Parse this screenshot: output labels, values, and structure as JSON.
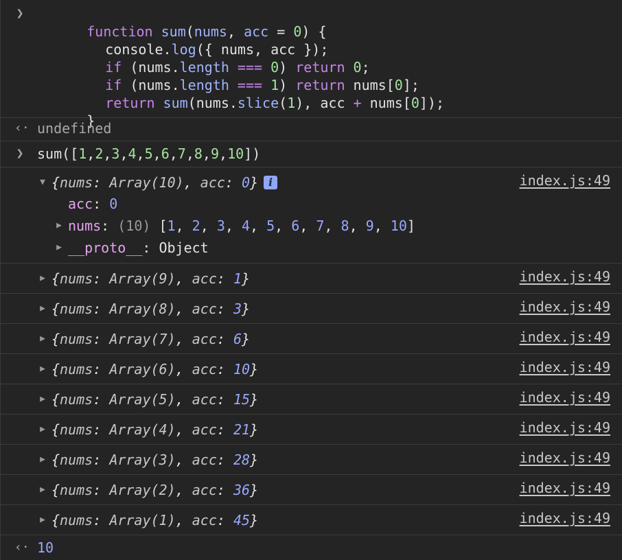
{
  "input1": {
    "code_lines": [
      [
        "function",
        "sum",
        "(",
        "nums",
        ", ",
        "acc",
        " = ",
        "0",
        ") {"
      ],
      [
        "console.",
        "log",
        "({ ",
        "nums",
        ", ",
        "acc",
        " });"
      ],
      [
        "if",
        " (nums.",
        "length",
        " === ",
        "0",
        ") ",
        "return",
        " ",
        "0",
        ";"
      ],
      [
        "if",
        " (nums.",
        "length",
        " === ",
        "1",
        ") ",
        "return",
        " nums[",
        "0",
        "];"
      ],
      [
        "return",
        " ",
        "sum",
        "(nums.",
        "slice",
        "(",
        "1",
        "), acc ",
        "+",
        " nums[",
        "0",
        "]);"
      ],
      [
        "}"
      ]
    ]
  },
  "output1": {
    "text": "undefined"
  },
  "input2": {
    "prefix": "sum([",
    "args": [
      "1",
      "2",
      "3",
      "4",
      "5",
      "6",
      "7",
      "8",
      "9",
      "10"
    ],
    "suffix": "])"
  },
  "expanded_log": {
    "summary_open": "{",
    "summary_key1": "nums",
    "summary_val1": "Array(10)",
    "summary_key2": "acc",
    "summary_val2": "0",
    "summary_close": "}",
    "info_icon": "i",
    "source": "index.js:49",
    "acc_key": "acc",
    "acc_value": "0",
    "nums_key": "nums",
    "nums_length": "(10)",
    "nums_values": [
      "1",
      "2",
      "3",
      "4",
      "5",
      "6",
      "7",
      "8",
      "9",
      "10"
    ],
    "proto_key": "__proto__",
    "proto_value": "Object"
  },
  "logs": [
    {
      "array": "Array(9)",
      "acc": "1",
      "source": "index.js:49"
    },
    {
      "array": "Array(8)",
      "acc": "3",
      "source": "index.js:49"
    },
    {
      "array": "Array(7)",
      "acc": "6",
      "source": "index.js:49"
    },
    {
      "array": "Array(6)",
      "acc": "10",
      "source": "index.js:49"
    },
    {
      "array": "Array(5)",
      "acc": "15",
      "source": "index.js:49"
    },
    {
      "array": "Array(4)",
      "acc": "21",
      "source": "index.js:49"
    },
    {
      "array": "Array(3)",
      "acc": "28",
      "source": "index.js:49"
    },
    {
      "array": "Array(2)",
      "acc": "36",
      "source": "index.js:49"
    },
    {
      "array": "Array(1)",
      "acc": "45",
      "source": "index.js:49"
    }
  ],
  "final_result": {
    "text": "10"
  },
  "icons": {
    "input_prompt": "chevron-right-icon",
    "output_prompt": "return-arrow-icon",
    "expand": "triangle-right-icon",
    "collapse": "triangle-down-icon"
  }
}
